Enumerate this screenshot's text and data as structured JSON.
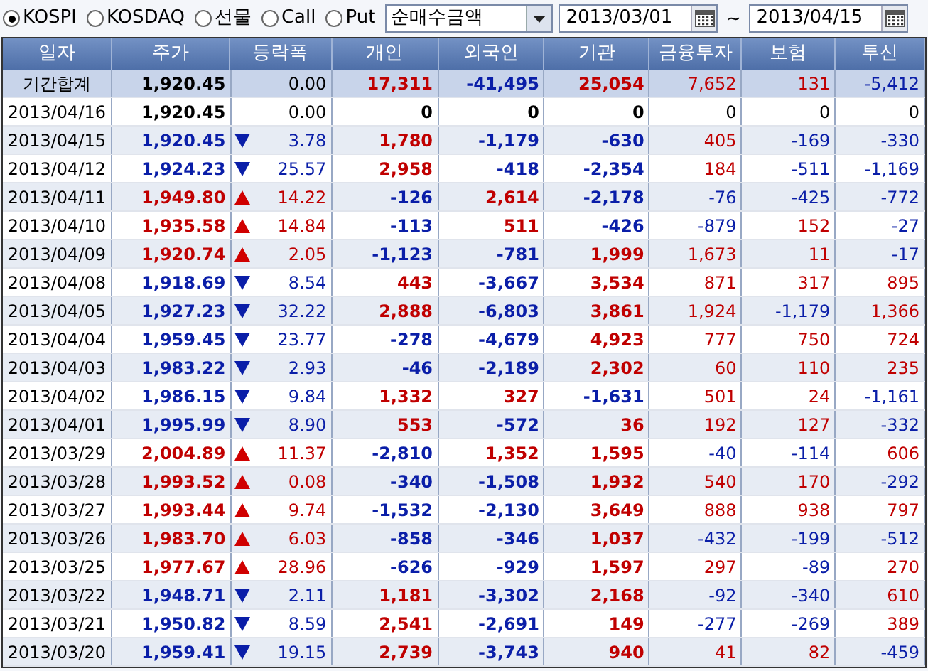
{
  "market_options": [
    {
      "label": "KOSPI",
      "selected": true
    },
    {
      "label": "KOSDAQ",
      "selected": false
    },
    {
      "label": "선물",
      "selected": false
    },
    {
      "label": "Call",
      "selected": false
    },
    {
      "label": "Put",
      "selected": false
    }
  ],
  "amount_type": {
    "value": "순매수금액"
  },
  "start_date": {
    "value": "2013/03/01"
  },
  "range_separator": "~",
  "end_date": {
    "value": "2013/04/15"
  },
  "table": {
    "columns": [
      "일자",
      "주가",
      "등락폭",
      "개인",
      "외국인",
      "기관",
      "금융투자",
      "보험",
      "투신"
    ],
    "summary": {
      "date": "기간합계",
      "price": "1,920.45",
      "color": "#000000",
      "change": "0.00",
      "values": [
        {
          "text": "17,311",
          "color": "#c00000"
        },
        {
          "text": "-41,495",
          "color": "#0a1ea8"
        },
        {
          "text": "25,054",
          "color": "#c00000"
        },
        {
          "text": "7,652",
          "color": "#c00000"
        },
        {
          "text": "131",
          "color": "#c00000"
        },
        {
          "text": "-5,412",
          "color": "#0a1ea8"
        }
      ]
    },
    "rows": [
      {
        "date": "2013/04/16",
        "price": "1,920.45",
        "color": "#000000",
        "rising": false,
        "falling": false,
        "change": "0.00",
        "values": [
          {
            "text": "0",
            "color": "#000000"
          },
          {
            "text": "0",
            "color": "#000000"
          },
          {
            "text": "0",
            "color": "#000000"
          },
          {
            "text": "0",
            "color": "#000000"
          },
          {
            "text": "0",
            "color": "#000000"
          },
          {
            "text": "0",
            "color": "#000000"
          }
        ]
      },
      {
        "date": "2013/04/15",
        "price": "1,920.45",
        "color": "#0a1ea8",
        "rising": false,
        "falling": true,
        "change": "3.78",
        "values": [
          {
            "text": "1,780",
            "color": "#c00000"
          },
          {
            "text": "-1,179",
            "color": "#0a1ea8"
          },
          {
            "text": "-630",
            "color": "#0a1ea8"
          },
          {
            "text": "405",
            "color": "#c00000"
          },
          {
            "text": "-169",
            "color": "#0a1ea8"
          },
          {
            "text": "-330",
            "color": "#0a1ea8"
          }
        ]
      },
      {
        "date": "2013/04/12",
        "price": "1,924.23",
        "color": "#0a1ea8",
        "rising": false,
        "falling": true,
        "change": "25.57",
        "values": [
          {
            "text": "2,958",
            "color": "#c00000"
          },
          {
            "text": "-418",
            "color": "#0a1ea8"
          },
          {
            "text": "-2,354",
            "color": "#0a1ea8"
          },
          {
            "text": "184",
            "color": "#c00000"
          },
          {
            "text": "-511",
            "color": "#0a1ea8"
          },
          {
            "text": "-1,169",
            "color": "#0a1ea8"
          }
        ]
      },
      {
        "date": "2013/04/11",
        "price": "1,949.80",
        "color": "#c00000",
        "rising": true,
        "falling": false,
        "change": "14.22",
        "values": [
          {
            "text": "-126",
            "color": "#0a1ea8"
          },
          {
            "text": "2,614",
            "color": "#c00000"
          },
          {
            "text": "-2,178",
            "color": "#0a1ea8"
          },
          {
            "text": "-76",
            "color": "#0a1ea8"
          },
          {
            "text": "-425",
            "color": "#0a1ea8"
          },
          {
            "text": "-772",
            "color": "#0a1ea8"
          }
        ]
      },
      {
        "date": "2013/04/10",
        "price": "1,935.58",
        "color": "#c00000",
        "rising": true,
        "falling": false,
        "change": "14.84",
        "values": [
          {
            "text": "-113",
            "color": "#0a1ea8"
          },
          {
            "text": "511",
            "color": "#c00000"
          },
          {
            "text": "-426",
            "color": "#0a1ea8"
          },
          {
            "text": "-879",
            "color": "#0a1ea8"
          },
          {
            "text": "152",
            "color": "#c00000"
          },
          {
            "text": "-27",
            "color": "#0a1ea8"
          }
        ]
      },
      {
        "date": "2013/04/09",
        "price": "1,920.74",
        "color": "#c00000",
        "rising": true,
        "falling": false,
        "change": "2.05",
        "values": [
          {
            "text": "-1,123",
            "color": "#0a1ea8"
          },
          {
            "text": "-781",
            "color": "#0a1ea8"
          },
          {
            "text": "1,999",
            "color": "#c00000"
          },
          {
            "text": "1,673",
            "color": "#c00000"
          },
          {
            "text": "11",
            "color": "#c00000"
          },
          {
            "text": "-17",
            "color": "#0a1ea8"
          }
        ]
      },
      {
        "date": "2013/04/08",
        "price": "1,918.69",
        "color": "#0a1ea8",
        "rising": false,
        "falling": true,
        "change": "8.54",
        "values": [
          {
            "text": "443",
            "color": "#c00000"
          },
          {
            "text": "-3,667",
            "color": "#0a1ea8"
          },
          {
            "text": "3,534",
            "color": "#c00000"
          },
          {
            "text": "871",
            "color": "#c00000"
          },
          {
            "text": "317",
            "color": "#c00000"
          },
          {
            "text": "895",
            "color": "#c00000"
          }
        ]
      },
      {
        "date": "2013/04/05",
        "price": "1,927.23",
        "color": "#0a1ea8",
        "rising": false,
        "falling": true,
        "change": "32.22",
        "values": [
          {
            "text": "2,888",
            "color": "#c00000"
          },
          {
            "text": "-6,803",
            "color": "#0a1ea8"
          },
          {
            "text": "3,861",
            "color": "#c00000"
          },
          {
            "text": "1,924",
            "color": "#c00000"
          },
          {
            "text": "-1,179",
            "color": "#0a1ea8"
          },
          {
            "text": "1,366",
            "color": "#c00000"
          }
        ]
      },
      {
        "date": "2013/04/04",
        "price": "1,959.45",
        "color": "#0a1ea8",
        "rising": false,
        "falling": true,
        "change": "23.77",
        "values": [
          {
            "text": "-278",
            "color": "#0a1ea8"
          },
          {
            "text": "-4,679",
            "color": "#0a1ea8"
          },
          {
            "text": "4,923",
            "color": "#c00000"
          },
          {
            "text": "777",
            "color": "#c00000"
          },
          {
            "text": "750",
            "color": "#c00000"
          },
          {
            "text": "724",
            "color": "#c00000"
          }
        ]
      },
      {
        "date": "2013/04/03",
        "price": "1,983.22",
        "color": "#0a1ea8",
        "rising": false,
        "falling": true,
        "change": "2.93",
        "values": [
          {
            "text": "-46",
            "color": "#0a1ea8"
          },
          {
            "text": "-2,189",
            "color": "#0a1ea8"
          },
          {
            "text": "2,302",
            "color": "#c00000"
          },
          {
            "text": "60",
            "color": "#c00000"
          },
          {
            "text": "110",
            "color": "#c00000"
          },
          {
            "text": "235",
            "color": "#c00000"
          }
        ]
      },
      {
        "date": "2013/04/02",
        "price": "1,986.15",
        "color": "#0a1ea8",
        "rising": false,
        "falling": true,
        "change": "9.84",
        "values": [
          {
            "text": "1,332",
            "color": "#c00000"
          },
          {
            "text": "327",
            "color": "#c00000"
          },
          {
            "text": "-1,631",
            "color": "#0a1ea8"
          },
          {
            "text": "501",
            "color": "#c00000"
          },
          {
            "text": "24",
            "color": "#c00000"
          },
          {
            "text": "-1,161",
            "color": "#0a1ea8"
          }
        ]
      },
      {
        "date": "2013/04/01",
        "price": "1,995.99",
        "color": "#0a1ea8",
        "rising": false,
        "falling": true,
        "change": "8.90",
        "values": [
          {
            "text": "553",
            "color": "#c00000"
          },
          {
            "text": "-572",
            "color": "#0a1ea8"
          },
          {
            "text": "36",
            "color": "#c00000"
          },
          {
            "text": "192",
            "color": "#c00000"
          },
          {
            "text": "127",
            "color": "#c00000"
          },
          {
            "text": "-332",
            "color": "#0a1ea8"
          }
        ]
      },
      {
        "date": "2013/03/29",
        "price": "2,004.89",
        "color": "#c00000",
        "rising": true,
        "falling": false,
        "change": "11.37",
        "values": [
          {
            "text": "-2,810",
            "color": "#0a1ea8"
          },
          {
            "text": "1,352",
            "color": "#c00000"
          },
          {
            "text": "1,595",
            "color": "#c00000"
          },
          {
            "text": "-40",
            "color": "#0a1ea8"
          },
          {
            "text": "-114",
            "color": "#0a1ea8"
          },
          {
            "text": "606",
            "color": "#c00000"
          }
        ]
      },
      {
        "date": "2013/03/28",
        "price": "1,993.52",
        "color": "#c00000",
        "rising": true,
        "falling": false,
        "change": "0.08",
        "values": [
          {
            "text": "-340",
            "color": "#0a1ea8"
          },
          {
            "text": "-1,508",
            "color": "#0a1ea8"
          },
          {
            "text": "1,932",
            "color": "#c00000"
          },
          {
            "text": "540",
            "color": "#c00000"
          },
          {
            "text": "170",
            "color": "#c00000"
          },
          {
            "text": "-292",
            "color": "#0a1ea8"
          }
        ]
      },
      {
        "date": "2013/03/27",
        "price": "1,993.44",
        "color": "#c00000",
        "rising": true,
        "falling": false,
        "change": "9.74",
        "values": [
          {
            "text": "-1,532",
            "color": "#0a1ea8"
          },
          {
            "text": "-2,130",
            "color": "#0a1ea8"
          },
          {
            "text": "3,649",
            "color": "#c00000"
          },
          {
            "text": "888",
            "color": "#c00000"
          },
          {
            "text": "938",
            "color": "#c00000"
          },
          {
            "text": "797",
            "color": "#c00000"
          }
        ]
      },
      {
        "date": "2013/03/26",
        "price": "1,983.70",
        "color": "#c00000",
        "rising": true,
        "falling": false,
        "change": "6.03",
        "values": [
          {
            "text": "-858",
            "color": "#0a1ea8"
          },
          {
            "text": "-346",
            "color": "#0a1ea8"
          },
          {
            "text": "1,037",
            "color": "#c00000"
          },
          {
            "text": "-432",
            "color": "#0a1ea8"
          },
          {
            "text": "-199",
            "color": "#0a1ea8"
          },
          {
            "text": "-512",
            "color": "#0a1ea8"
          }
        ]
      },
      {
        "date": "2013/03/25",
        "price": "1,977.67",
        "color": "#c00000",
        "rising": true,
        "falling": false,
        "change": "28.96",
        "values": [
          {
            "text": "-626",
            "color": "#0a1ea8"
          },
          {
            "text": "-929",
            "color": "#0a1ea8"
          },
          {
            "text": "1,597",
            "color": "#c00000"
          },
          {
            "text": "297",
            "color": "#c00000"
          },
          {
            "text": "-89",
            "color": "#0a1ea8"
          },
          {
            "text": "270",
            "color": "#c00000"
          }
        ]
      },
      {
        "date": "2013/03/22",
        "price": "1,948.71",
        "color": "#0a1ea8",
        "rising": false,
        "falling": true,
        "change": "2.11",
        "values": [
          {
            "text": "1,181",
            "color": "#c00000"
          },
          {
            "text": "-3,302",
            "color": "#0a1ea8"
          },
          {
            "text": "2,168",
            "color": "#c00000"
          },
          {
            "text": "-92",
            "color": "#0a1ea8"
          },
          {
            "text": "-340",
            "color": "#0a1ea8"
          },
          {
            "text": "610",
            "color": "#c00000"
          }
        ]
      },
      {
        "date": "2013/03/21",
        "price": "1,950.82",
        "color": "#0a1ea8",
        "rising": false,
        "falling": true,
        "change": "8.59",
        "values": [
          {
            "text": "2,541",
            "color": "#c00000"
          },
          {
            "text": "-2,691",
            "color": "#0a1ea8"
          },
          {
            "text": "149",
            "color": "#c00000"
          },
          {
            "text": "-277",
            "color": "#0a1ea8"
          },
          {
            "text": "-269",
            "color": "#0a1ea8"
          },
          {
            "text": "389",
            "color": "#c00000"
          }
        ]
      },
      {
        "date": "2013/03/20",
        "price": "1,959.41",
        "color": "#0a1ea8",
        "rising": false,
        "falling": true,
        "change": "19.15",
        "values": [
          {
            "text": "2,739",
            "color": "#c00000"
          },
          {
            "text": "-3,743",
            "color": "#0a1ea8"
          },
          {
            "text": "940",
            "color": "#c00000"
          },
          {
            "text": "41",
            "color": "#c00000"
          },
          {
            "text": "82",
            "color": "#c00000"
          },
          {
            "text": "-459",
            "color": "#0a1ea8"
          }
        ]
      }
    ]
  }
}
